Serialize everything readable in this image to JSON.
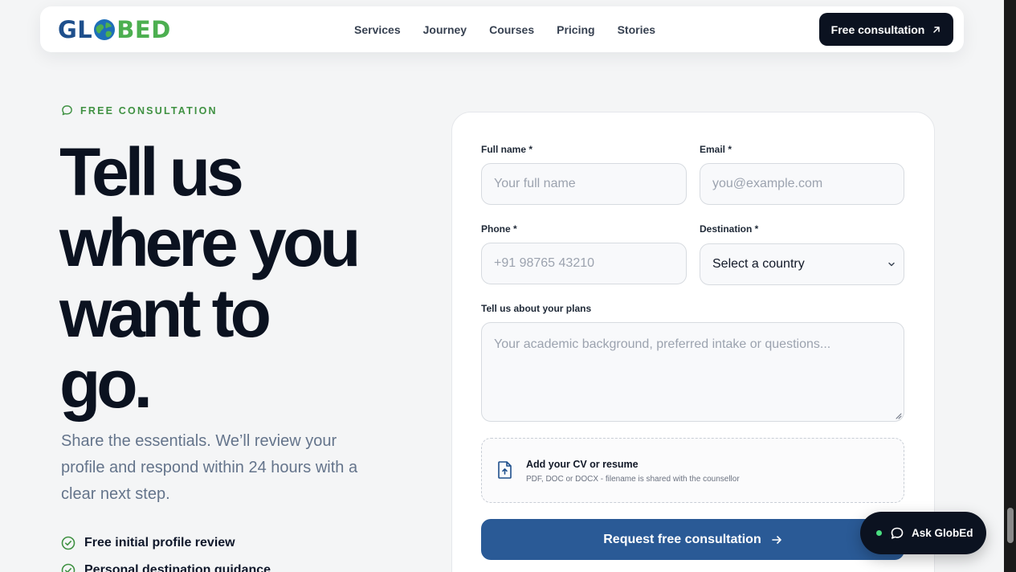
{
  "brand": {
    "logo_left": "GL",
    "logo_right": "BED",
    "primary_color": "#1e4f8c",
    "accent_color": "#4caf50"
  },
  "nav": {
    "links": [
      "Services",
      "Journey",
      "Courses",
      "Pricing",
      "Stories"
    ],
    "cta_label": "Free consultation"
  },
  "hero": {
    "eyebrow": "FREE CONSULTATION",
    "title_lines": [
      "Tell us",
      "where you",
      "want to",
      "go."
    ],
    "subtitle": "Share the essentials. We’ll review your profile and respond within 24 hours with a clear next step.",
    "features": [
      "Free initial profile review",
      "Personal destination guidance"
    ]
  },
  "form": {
    "full_name": {
      "label": "Full name *",
      "placeholder": "Your full name",
      "value": ""
    },
    "email": {
      "label": "Email *",
      "placeholder": "you@example.com",
      "value": ""
    },
    "phone": {
      "label": "Phone *",
      "placeholder": "+91 98765 43210",
      "value": ""
    },
    "destination": {
      "label": "Destination *",
      "selected": "Select a country"
    },
    "plans": {
      "label": "Tell us about your plans",
      "placeholder": "Your academic background, preferred intake or questions...",
      "value": ""
    },
    "upload": {
      "title": "Add your CV or resume",
      "hint": "PDF, DOC or DOCX - filename is shared with the counsellor"
    },
    "submit_label": "Request free consultation"
  },
  "chat": {
    "label": "Ask GlobEd",
    "status_color": "#4ade80"
  }
}
